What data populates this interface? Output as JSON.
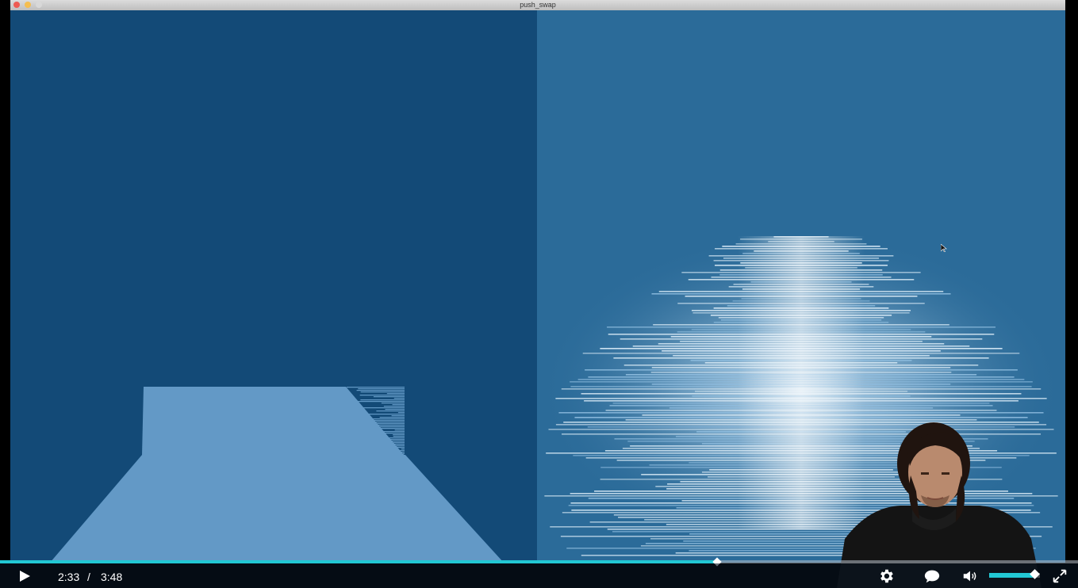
{
  "window": {
    "title": "push_swap",
    "buttons": [
      "close",
      "minimize",
      "zoom"
    ],
    "colors": {
      "close": "#ee5a52",
      "minimize": "#f5be4f",
      "zoom": "#d8d8d8"
    }
  },
  "visualizer": {
    "stack_a_color": "#134a77",
    "stack_b_color": "#2b6b99",
    "bar_color_a": "#6399c6",
    "bar_color_b_light": "#d7e9f5",
    "bar_color_b_mid": "#8fbddf"
  },
  "player": {
    "current_time": "2:33",
    "separator": "/",
    "duration": "3:48",
    "progress": 0.665,
    "volume": 0.9,
    "accent_color": "#22c8d4",
    "icons": [
      "play-icon",
      "settings-gear-icon",
      "captions-icon",
      "volume-icon",
      "fullscreen-icon"
    ]
  }
}
